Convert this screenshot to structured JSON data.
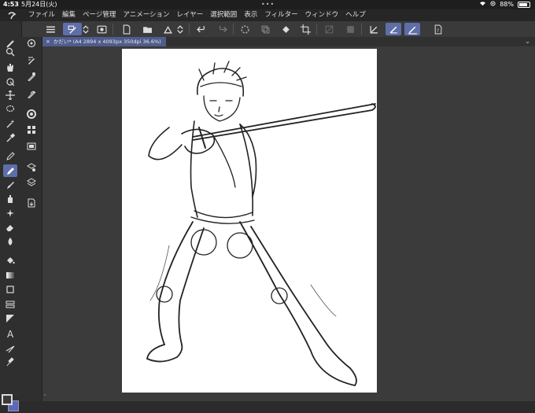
{
  "status": {
    "time": "4:53",
    "date": "5月24日(火)",
    "dots": "•••",
    "battery_percent": "88%",
    "battery_level": 0.88
  },
  "menu": {
    "items": [
      "ファイル",
      "編集",
      "ページ管理",
      "アニメーション",
      "レイヤー",
      "選択範囲",
      "表示",
      "フィルター",
      "ウィンドウ",
      "ヘルプ"
    ]
  },
  "tab": {
    "label": "かだい* (A4 2894 x 4093px 350dpi 36.6%)",
    "close": "×"
  },
  "collapse": {
    "left": "«",
    "right": "«",
    "expand": "⌄"
  },
  "colors": {
    "foreground": "#3a3a3a",
    "background": "#5c68c0",
    "accent": "#5d6ea8"
  }
}
